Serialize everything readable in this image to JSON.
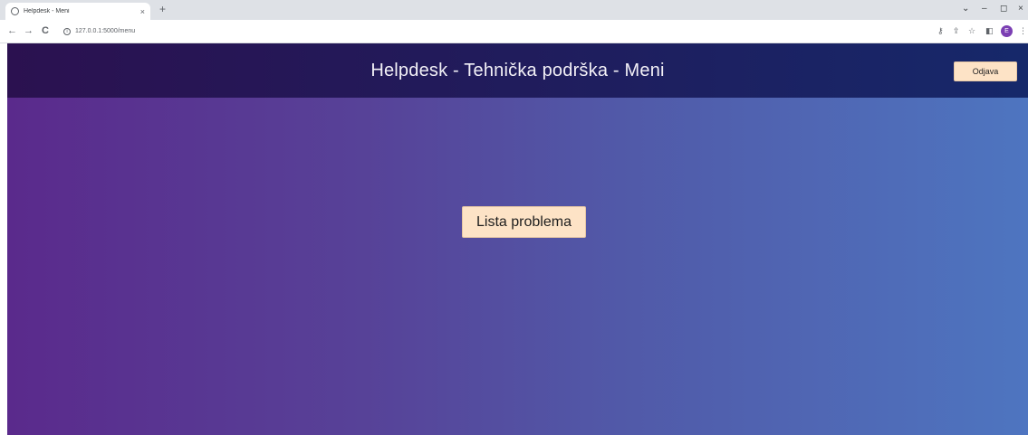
{
  "browser": {
    "tab_title": "Helpdesk - Meni",
    "tab_close": "×",
    "new_tab": "+",
    "url": "127.0.0.1:5000/menu",
    "back": "←",
    "forward": "→",
    "reload": "C",
    "min": "⌄",
    "minimize": "–",
    "restore": "◻",
    "close": "×",
    "profile_initial": "E"
  },
  "header": {
    "title": "Helpdesk - Tehnička podrška - Meni",
    "logout_label": "Odjava"
  },
  "main": {
    "problems_button_label": "Lista problema"
  },
  "colors": {
    "header_bg": "#201c5c",
    "page_gradient_start": "#5a2a8c",
    "page_gradient_end": "#4e75c0",
    "button_bg": "#fde3c6"
  }
}
